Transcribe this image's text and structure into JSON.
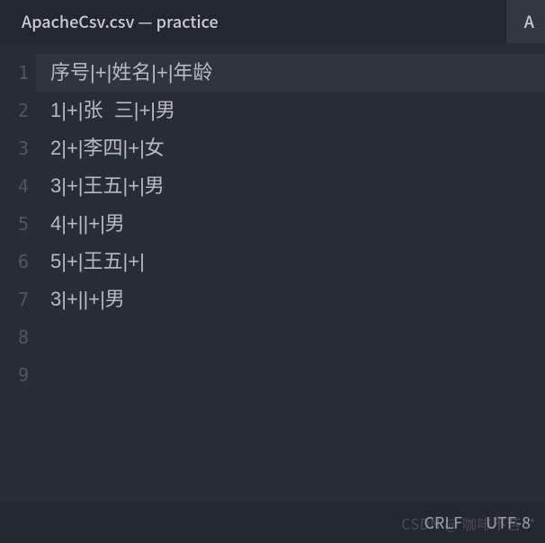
{
  "tabs": {
    "active": "ApacheCsv.csv — practice",
    "inactive_prefix": "A"
  },
  "editor": {
    "current_line": 1,
    "lines": [
      "序号|+|姓名|+|年龄",
      "1|+|张  三|+|男",
      "2|+|李四|+|女",
      "3|+|王五|+|男",
      "4|+||+|男",
      "5|+|王五|+|",
      "3|+||+|男",
      "",
      ""
    ]
  },
  "statusbar": {
    "line_ending": "CRLF",
    "encoding": "UTF-8"
  },
  "watermark": "CSDN @ 咖啡不苦**"
}
